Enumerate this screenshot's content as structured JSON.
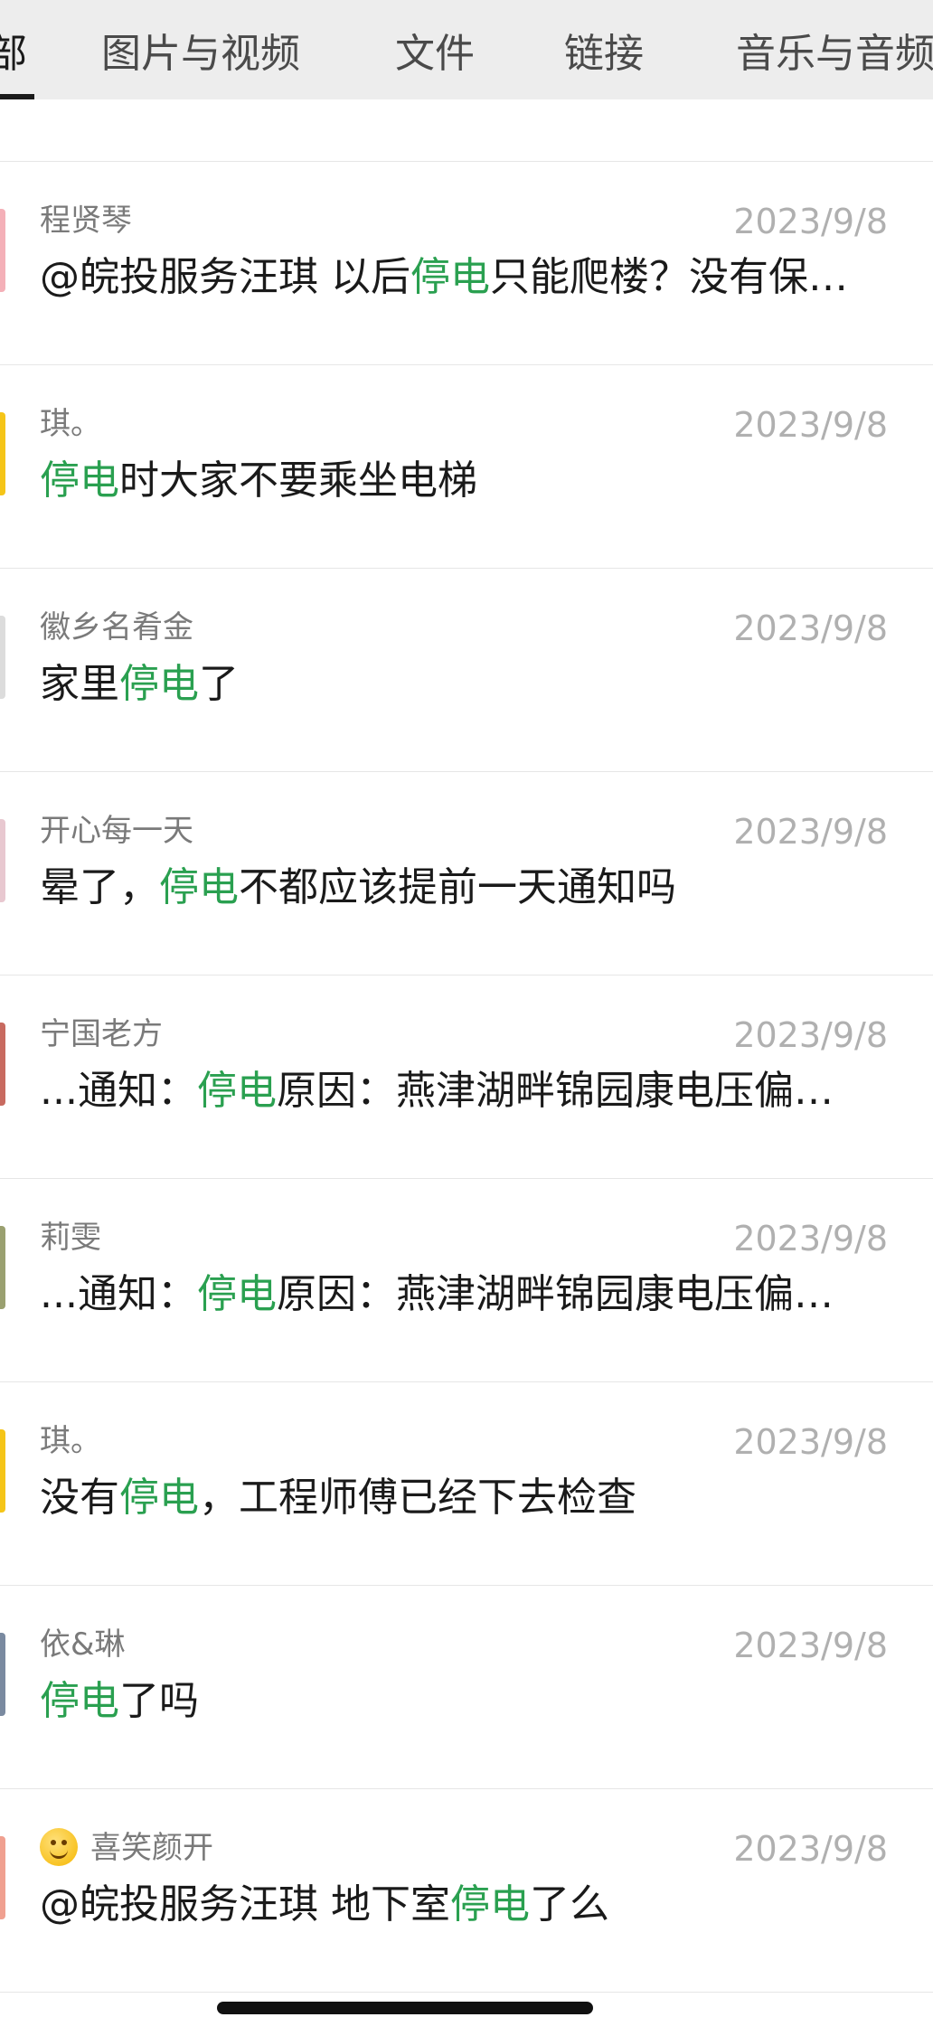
{
  "tabs": [
    {
      "label": "部",
      "active": true
    },
    {
      "label": "图片与视频",
      "active": false
    },
    {
      "label": "文件",
      "active": false
    },
    {
      "label": "链接",
      "active": false
    },
    {
      "label": "音乐与音频",
      "active": false
    }
  ],
  "highlight_color": "#2aa050",
  "results": [
    {
      "sender": "程贤琴",
      "date": "2023/9/8",
      "pre": "@皖投服务汪琪 以后",
      "hl": "停电",
      "post": "只能爬楼？没有保…",
      "avatar_color": "#f4b0b8"
    },
    {
      "sender": "琪。",
      "date": "2023/9/8",
      "pre": "",
      "hl": "停电",
      "post": "时大家不要乘坐电梯",
      "avatar_color": "#f5c518"
    },
    {
      "sender": "徽乡名肴金",
      "date": "2023/9/8",
      "pre": "家里",
      "hl": "停电",
      "post": "了",
      "avatar_color": "#dcdcdc"
    },
    {
      "sender": "开心每一天",
      "date": "2023/9/8",
      "pre": "晕了，",
      "hl": "停电",
      "post": "不都应该提前一天通知吗",
      "avatar_color": "#e8c8d0"
    },
    {
      "sender": "宁国老方",
      "date": "2023/9/8",
      "pre": "...通知：",
      "hl": "停电",
      "post": "原因：燕津湖畔锦园康电压偏…",
      "avatar_color": "#c86a60"
    },
    {
      "sender": "莉雯",
      "date": "2023/9/8",
      "pre": "...通知：",
      "hl": "停电",
      "post": "原因：燕津湖畔锦园康电压偏…",
      "avatar_color": "#9aa070"
    },
    {
      "sender": "琪。",
      "date": "2023/9/8",
      "pre": "没有",
      "hl": "停电",
      "post": "，工程师傅已经下去检查",
      "avatar_color": "#f5c518"
    },
    {
      "sender": "依&琳",
      "date": "2023/9/8",
      "pre": "",
      "hl": "停电",
      "post": "了吗",
      "avatar_color": "#7a8aa0"
    },
    {
      "sender": "喜笑颜开",
      "sender_emoji": "smiling-face",
      "date": "2023/9/8",
      "pre": "@皖投服务汪琪 地下室",
      "hl": "停电",
      "post": "了么",
      "avatar_color": "#f0a090"
    }
  ]
}
